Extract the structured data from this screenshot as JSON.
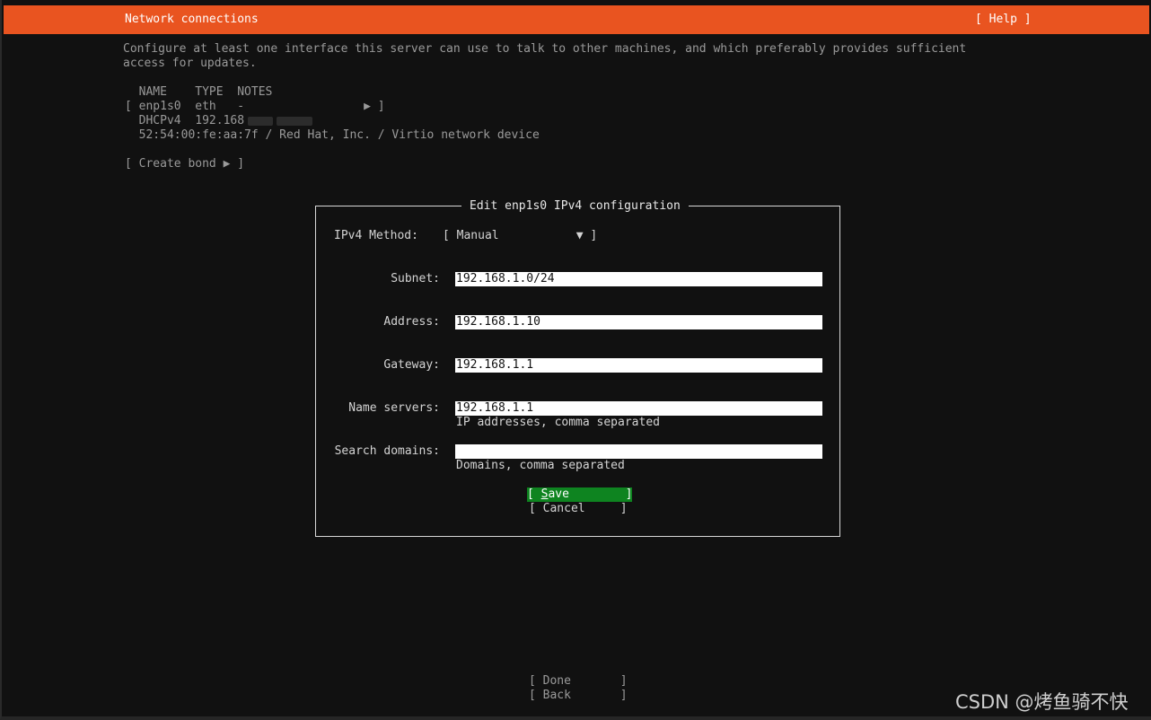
{
  "header": {
    "title": "Network connections",
    "help": "[ Help ]"
  },
  "description": {
    "line1": "Configure at least one interface this server can use to talk to other machines, and which preferably provides sufficient",
    "line2": "access for updates."
  },
  "interfaces": {
    "columns": "  NAME    TYPE  NOTES",
    "row": "[ enp1s0  eth   -                 ▶ ]",
    "dhcp_prefix": "  DHCPv4  192.168",
    "device": "  52:54:00:fe:aa:7f / Red Hat, Inc. / Virtio network device"
  },
  "create_bond": "[ Create bond ▶ ]",
  "dialog": {
    "title": "Edit enp1s0 IPv4 configuration",
    "method_label": "IPv4 Method:",
    "method_value": "[ Manual           ▼ ]",
    "subnet": {
      "label": "Subnet:",
      "value": "192.168.1.0/24"
    },
    "address": {
      "label": "Address:",
      "value": "192.168.1.10"
    },
    "gateway": {
      "label": "Gateway:",
      "value": "192.168.1.1"
    },
    "name_servers": {
      "label": "Name servers:",
      "value": "192.168.1.1",
      "hint": "IP addresses, comma separated"
    },
    "search_domains": {
      "label": "Search domains:",
      "value": "",
      "hint": "Domains, comma separated"
    },
    "save": {
      "open": "[ ",
      "key": "S",
      "rest": "ave",
      "close": "        ]"
    },
    "cancel": "[ Cancel     ]"
  },
  "footer": {
    "done": "[ Done       ]",
    "back": "[ Back       ]"
  },
  "watermark": "CSDN @烤鱼骑不快",
  "colors": {
    "accent": "#e95420",
    "button_selected": "#0e8420",
    "background": "#111111"
  }
}
